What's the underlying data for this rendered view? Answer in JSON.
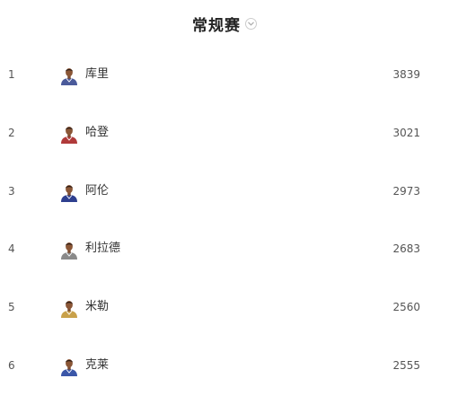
{
  "header": {
    "title": "常规赛",
    "dropdown_icon": "chevron-down-icon"
  },
  "players": [
    {
      "rank": "1",
      "name": "库里",
      "score": "3839",
      "avatar_icon": "player-avatar-icon",
      "jersey_color": "#4a5a9a"
    },
    {
      "rank": "2",
      "name": "哈登",
      "score": "3021",
      "avatar_icon": "player-avatar-icon",
      "jersey_color": "#b03a3a"
    },
    {
      "rank": "3",
      "name": "阿伦",
      "score": "2973",
      "avatar_icon": "player-avatar-icon",
      "jersey_color": "#2e3f8f"
    },
    {
      "rank": "4",
      "name": "利拉德",
      "score": "2683",
      "avatar_icon": "player-avatar-icon",
      "jersey_color": "#8a8a8a"
    },
    {
      "rank": "5",
      "name": "米勒",
      "score": "2560",
      "avatar_icon": "player-avatar-icon",
      "jersey_color": "#c9a14a"
    },
    {
      "rank": "6",
      "name": "克莱",
      "score": "2555",
      "avatar_icon": "player-avatar-icon",
      "jersey_color": "#3a56a8"
    }
  ]
}
